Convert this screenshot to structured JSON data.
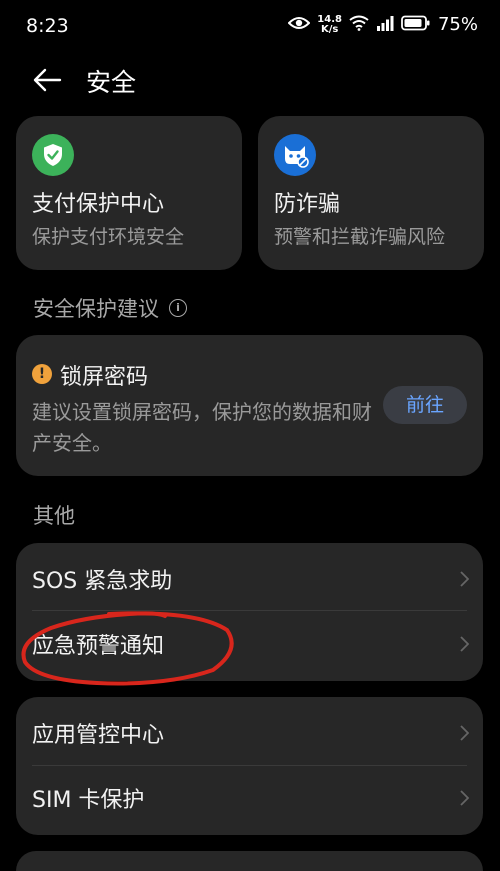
{
  "status": {
    "time": "8:23",
    "speed_value": "14.8",
    "speed_unit": "K/s",
    "battery": "75%"
  },
  "header": {
    "title": "安全"
  },
  "features": [
    {
      "title": "支付保护中心",
      "subtitle": "保护支付环境安全",
      "icon": "shield-check-icon",
      "color": "#3cb25a"
    },
    {
      "title": "防诈骗",
      "subtitle": "预警和拦截诈骗风险",
      "icon": "anti-fraud-icon",
      "color": "#1a6fd6"
    }
  ],
  "suggestion_section": {
    "label": "安全保护建议"
  },
  "lock_card": {
    "title": "锁屏密码",
    "desc": "建议设置锁屏密码，保护您的数据和财产安全。",
    "button": "前往"
  },
  "other_section": {
    "label": "其他"
  },
  "group1": [
    {
      "label": "SOS 紧急求助"
    },
    {
      "label": "应急预警通知"
    }
  ],
  "group2": [
    {
      "label": "应用管控中心"
    },
    {
      "label": "SIM 卡保护"
    }
  ],
  "colors": {
    "accent": "#6aa5ff",
    "card": "#272727",
    "annotation": "#d8261c"
  }
}
